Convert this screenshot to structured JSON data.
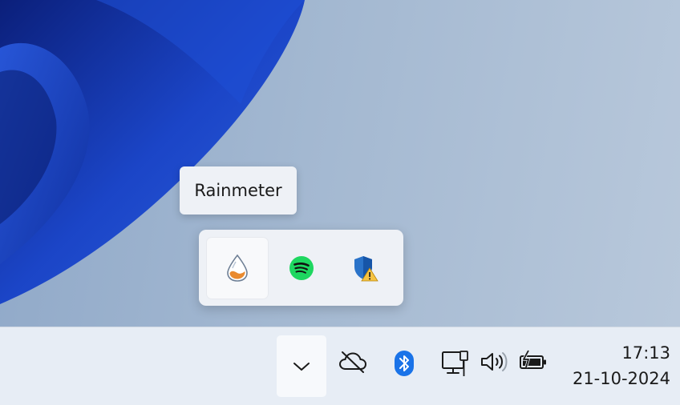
{
  "tooltip": {
    "text": "Rainmeter"
  },
  "tray_flyout": {
    "items": [
      {
        "name": "Rainmeter",
        "icon": "rainmeter-drop-icon",
        "hovered": true
      },
      {
        "name": "Spotify",
        "icon": "spotify-icon",
        "hovered": false
      },
      {
        "name": "Windows Security",
        "icon": "security-warning-icon",
        "hovered": false
      }
    ]
  },
  "taskbar": {
    "overflow_icon": "chevron-down-icon",
    "tray_icons": [
      "cloud-offline-icon",
      "bluetooth-icon",
      "network-ethernet-icon",
      "volume-icon",
      "battery-charging-icon"
    ],
    "clock": {
      "time": "17:13",
      "date": "21-10-2024"
    }
  },
  "colors": {
    "wallpaper_blue": "#1a3fb8",
    "spotify_green": "#1ed760",
    "bluetooth_blue": "#1a73e8",
    "shield_blue": "#2a73c9",
    "warning_yellow": "#f6c343"
  }
}
